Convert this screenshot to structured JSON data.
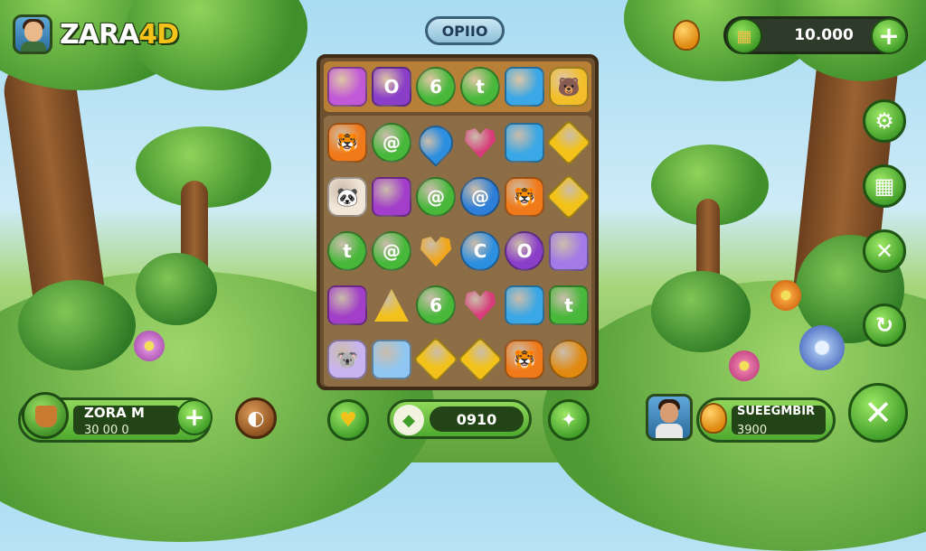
{
  "header": {
    "brand_main": "ZARA",
    "brand_accent": "4D",
    "level_label": "OPIIO",
    "currency_value": "10.000",
    "plus_label": "+"
  },
  "board": {
    "top_row": [
      {
        "shape": "square",
        "color": "#c25ad8",
        "glyph": ""
      },
      {
        "shape": "square",
        "color": "#8b3fc9",
        "glyph": "O"
      },
      {
        "shape": "circle",
        "color": "#48b83b",
        "glyph": "6"
      },
      {
        "shape": "circle",
        "color": "#48b83b",
        "glyph": "t"
      },
      {
        "shape": "square",
        "color": "#3aa7e6",
        "glyph": ""
      },
      {
        "shape": "animal",
        "color": "#f2bf2a",
        "glyph": "🐻"
      }
    ],
    "rows": [
      [
        {
          "shape": "animal",
          "color": "#f07a1a",
          "glyph": "🐯"
        },
        {
          "shape": "circle",
          "color": "#48b83b",
          "glyph": "@"
        },
        {
          "shape": "drop",
          "color": "#2d8fe0",
          "glyph": ""
        },
        {
          "shape": "heart",
          "color": "#d83c7a",
          "glyph": ""
        },
        {
          "shape": "square",
          "color": "#3aa7e6",
          "glyph": ""
        },
        {
          "shape": "diamond",
          "color": "#f2c21a",
          "glyph": ""
        }
      ],
      [
        {
          "shape": "animal",
          "color": "#f2e6d8",
          "glyph": "🐼"
        },
        {
          "shape": "square",
          "color": "#a23ec9",
          "glyph": ""
        },
        {
          "shape": "circle",
          "color": "#48b83b",
          "glyph": "@"
        },
        {
          "shape": "circle",
          "color": "#2d7fd8",
          "glyph": "@"
        },
        {
          "shape": "animal",
          "color": "#f07a1a",
          "glyph": "🐯"
        },
        {
          "shape": "diamond",
          "color": "#f2c21a",
          "glyph": ""
        }
      ],
      [
        {
          "shape": "circle",
          "color": "#48b83b",
          "glyph": "t"
        },
        {
          "shape": "circle",
          "color": "#48b83b",
          "glyph": "@"
        },
        {
          "shape": "heart",
          "color": "#f2a61a",
          "glyph": ""
        },
        {
          "shape": "circle",
          "color": "#2d8fe0",
          "glyph": "C"
        },
        {
          "shape": "circle",
          "color": "#8b3fc9",
          "glyph": "O"
        },
        {
          "shape": "square",
          "color": "#a37ae8",
          "glyph": ""
        }
      ],
      [
        {
          "shape": "square",
          "color": "#a23ec9",
          "glyph": ""
        },
        {
          "shape": "tri",
          "color": "#f2c21a",
          "glyph": ""
        },
        {
          "shape": "circle",
          "color": "#48b83b",
          "glyph": "6"
        },
        {
          "shape": "heart",
          "color": "#d83c7a",
          "glyph": ""
        },
        {
          "shape": "square",
          "color": "#3aa7e6",
          "glyph": ""
        },
        {
          "shape": "square",
          "color": "#48b83b",
          "glyph": "t"
        }
      ],
      [
        {
          "shape": "animal",
          "color": "#c9b4f2",
          "glyph": "🐨"
        },
        {
          "shape": "square",
          "color": "#8fc7f2",
          "glyph": ""
        },
        {
          "shape": "diamond",
          "color": "#f2c21a",
          "glyph": ""
        },
        {
          "shape": "diamond",
          "color": "#f2c21a",
          "glyph": ""
        },
        {
          "shape": "animal",
          "color": "#f07a1a",
          "glyph": "🐯"
        },
        {
          "shape": "circle",
          "color": "#e08a12",
          "glyph": ""
        }
      ]
    ]
  },
  "side_buttons": [
    {
      "icon": "gear-icon",
      "glyph": "⚙"
    },
    {
      "icon": "map-icon",
      "glyph": "▦"
    },
    {
      "icon": "close-icon",
      "glyph": "✕"
    },
    {
      "icon": "refresh-icon",
      "glyph": "↻"
    }
  ],
  "bottom": {
    "player_name": "ZORA M",
    "player_score": "30 00 0",
    "plus_label": "+",
    "score_value": "0910",
    "opponent_name": "SUEEGMBIR",
    "opponent_score": "3900",
    "close_label": "✕"
  }
}
